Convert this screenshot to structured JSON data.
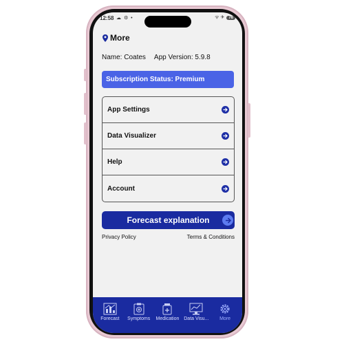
{
  "statusbar": {
    "time": "12:58",
    "left_icons": "☁ ⚙ •",
    "signal": "ᯤ ✈",
    "battery": "76"
  },
  "page": {
    "title": "More"
  },
  "user": {
    "name_text": "Name: Coates",
    "version_text": "App Version: 5.9.8"
  },
  "subscription": {
    "status_text": "Subscription Status: Premium"
  },
  "menu": {
    "items": [
      {
        "label": "App Settings"
      },
      {
        "label": "Data Visualizer"
      },
      {
        "label": "Help"
      },
      {
        "label": "Account"
      }
    ]
  },
  "forecast": {
    "button_label": "Forecast explanation"
  },
  "links": {
    "privacy": "Privacy Policy",
    "terms": "Terms & Conditions"
  },
  "tabs": [
    {
      "label": "Forecast",
      "icon": "chart-icon"
    },
    {
      "label": "Symptoms",
      "icon": "clipboard-icon"
    },
    {
      "label": "Medication",
      "icon": "pill-bottle-icon"
    },
    {
      "label": "Data Visu...",
      "icon": "monitor-chart-icon"
    },
    {
      "label": "More",
      "icon": "gear-icon",
      "active": true
    }
  ],
  "colors": {
    "accent": "#1a2ba0",
    "banner": "#4a63e6",
    "active_tab": "#9fb0ff"
  }
}
